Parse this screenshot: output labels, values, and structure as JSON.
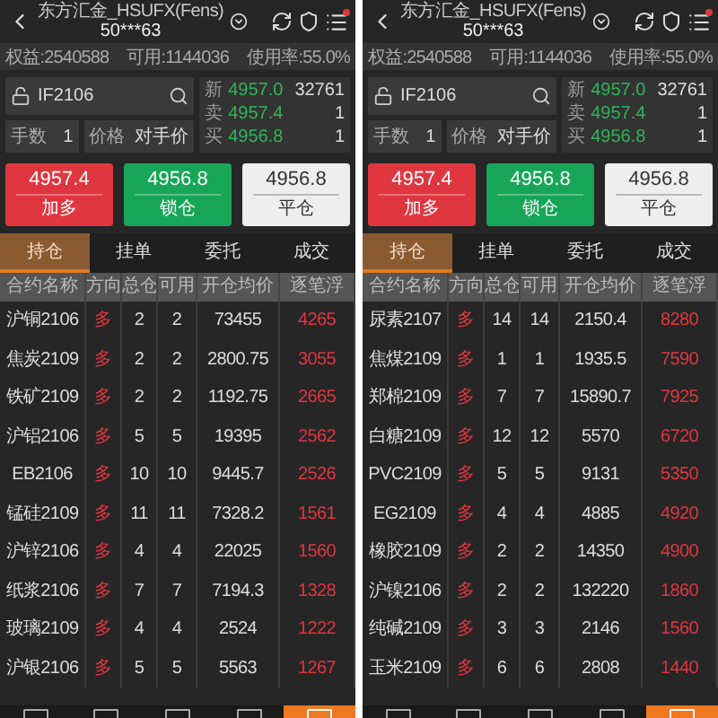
{
  "panels": [
    {
      "header": {
        "broker": "东方汇金_HSUFX(Fens)",
        "account": "50***63"
      },
      "summary": [
        "权益:2540588",
        "可用:1144036",
        "使用率:55.0%"
      ],
      "order": {
        "symbol": "IF2106",
        "qty_label": "手数",
        "qty": "1",
        "price_label": "价格",
        "price_mode": "对手价"
      },
      "quote": [
        {
          "label": "新",
          "price": "4957.0",
          "volume": "32761"
        },
        {
          "label": "卖",
          "price": "4957.4",
          "volume": "1"
        },
        {
          "label": "买",
          "price": "4956.8",
          "volume": "1"
        }
      ],
      "buttons": [
        {
          "kind": "buy",
          "price": "4957.4",
          "label": "加多"
        },
        {
          "kind": "sell",
          "price": "4956.8",
          "label": "锁仓"
        },
        {
          "kind": "close",
          "price": "4956.8",
          "label": "平仓"
        }
      ],
      "tabs": [
        {
          "label": "持仓",
          "selected": true
        },
        {
          "label": "挂单",
          "selected": false
        },
        {
          "label": "委托",
          "selected": false
        },
        {
          "label": "成交",
          "selected": false
        }
      ],
      "columns": [
        "合约名称",
        "方向",
        "总仓",
        "可用",
        "开仓均价",
        "逐笔浮"
      ],
      "rows": [
        {
          "name": "沪铜2106",
          "direction": "多",
          "total": "2",
          "available": "2",
          "avg_price": "73455",
          "column_6": "4265"
        },
        {
          "name": "焦炭2109",
          "direction": "多",
          "total": "2",
          "available": "2",
          "avg_price": "2800.75",
          "column_6": "3055"
        },
        {
          "name": "铁矿2109",
          "direction": "多",
          "total": "2",
          "available": "2",
          "avg_price": "1192.75",
          "column_6": "2665"
        },
        {
          "name": "沪铝2106",
          "direction": "多",
          "total": "5",
          "available": "5",
          "avg_price": "19395",
          "column_6": "2562"
        },
        {
          "name": "EB2106",
          "direction": "多",
          "total": "10",
          "available": "10",
          "avg_price": "9445.7",
          "column_6": "2526"
        },
        {
          "name": "锰硅2109",
          "direction": "多",
          "total": "11",
          "available": "11",
          "avg_price": "7328.2",
          "column_6": "1561"
        },
        {
          "name": "沪锌2106",
          "direction": "多",
          "total": "4",
          "available": "4",
          "avg_price": "22025",
          "column_6": "1560"
        },
        {
          "name": "纸浆2106",
          "direction": "多",
          "total": "7",
          "available": "7",
          "avg_price": "7194.3",
          "column_6": "1328"
        },
        {
          "name": "玻璃2109",
          "direction": "多",
          "total": "4",
          "available": "4",
          "avg_price": "2524",
          "column_6": "1222"
        },
        {
          "name": "沪银2106",
          "direction": "多",
          "total": "5",
          "available": "5",
          "avg_price": "5563",
          "column_6": "1267"
        }
      ],
      "bottom_tabs": [
        {
          "selected": false
        },
        {
          "selected": false
        },
        {
          "selected": false
        },
        {
          "selected": false
        },
        {
          "selected": true
        }
      ]
    },
    {
      "header": {
        "broker": "东方汇金_HSUFX(Fens)",
        "account": "50***63"
      },
      "summary": [
        "权益:2540588",
        "可用:1144036",
        "使用率:55.0%"
      ],
      "order": {
        "symbol": "IF2106",
        "qty_label": "手数",
        "qty": "1",
        "price_label": "价格",
        "price_mode": "对手价"
      },
      "quote": [
        {
          "label": "新",
          "price": "4957.0",
          "volume": "32761"
        },
        {
          "label": "卖",
          "price": "4957.4",
          "volume": "1"
        },
        {
          "label": "买",
          "price": "4956.8",
          "volume": "1"
        }
      ],
      "buttons": [
        {
          "kind": "buy",
          "price": "4957.4",
          "label": "加多"
        },
        {
          "kind": "sell",
          "price": "4956.8",
          "label": "锁仓"
        },
        {
          "kind": "close",
          "price": "4956.8",
          "label": "平仓"
        }
      ],
      "tabs": [
        {
          "label": "持仓",
          "selected": true
        },
        {
          "label": "挂单",
          "selected": false
        },
        {
          "label": "委托",
          "selected": false
        },
        {
          "label": "成交",
          "selected": false
        }
      ],
      "columns": [
        "合约名称",
        "方向",
        "总仓",
        "可用",
        "开仓均价",
        "逐笔浮"
      ],
      "rows": [
        {
          "name": "尿素2107",
          "direction": "多",
          "total": "14",
          "available": "14",
          "avg_price": "2150.4",
          "column_6": "8280"
        },
        {
          "name": "焦煤2109",
          "direction": "多",
          "total": "1",
          "available": "1",
          "avg_price": "1935.5",
          "column_6": "7590"
        },
        {
          "name": "郑棉2109",
          "direction": "多",
          "total": "7",
          "available": "7",
          "avg_price": "15890.7",
          "column_6": "7925"
        },
        {
          "name": "白糖2109",
          "direction": "多",
          "total": "12",
          "available": "12",
          "avg_price": "5570",
          "column_6": "6720"
        },
        {
          "name": "PVC2109",
          "direction": "多",
          "total": "5",
          "available": "5",
          "avg_price": "9131",
          "column_6": "5350"
        },
        {
          "name": "EG2109",
          "direction": "多",
          "total": "4",
          "available": "4",
          "avg_price": "4885",
          "column_6": "4920"
        },
        {
          "name": "橡胶2109",
          "direction": "多",
          "total": "2",
          "available": "2",
          "avg_price": "14350",
          "column_6": "4900"
        },
        {
          "name": "沪镍2106",
          "direction": "多",
          "total": "2",
          "available": "2",
          "avg_price": "132220",
          "column_6": "1860"
        },
        {
          "name": "纯碱2109",
          "direction": "多",
          "total": "3",
          "available": "3",
          "avg_price": "2146",
          "column_6": "1560"
        },
        {
          "name": "玉米2109",
          "direction": "多",
          "total": "6",
          "available": "6",
          "avg_price": "2808",
          "column_6": "1440"
        }
      ],
      "bottom_tabs": [
        {
          "selected": false
        },
        {
          "selected": false
        },
        {
          "selected": false
        },
        {
          "selected": false
        },
        {
          "selected": true
        }
      ]
    }
  ]
}
